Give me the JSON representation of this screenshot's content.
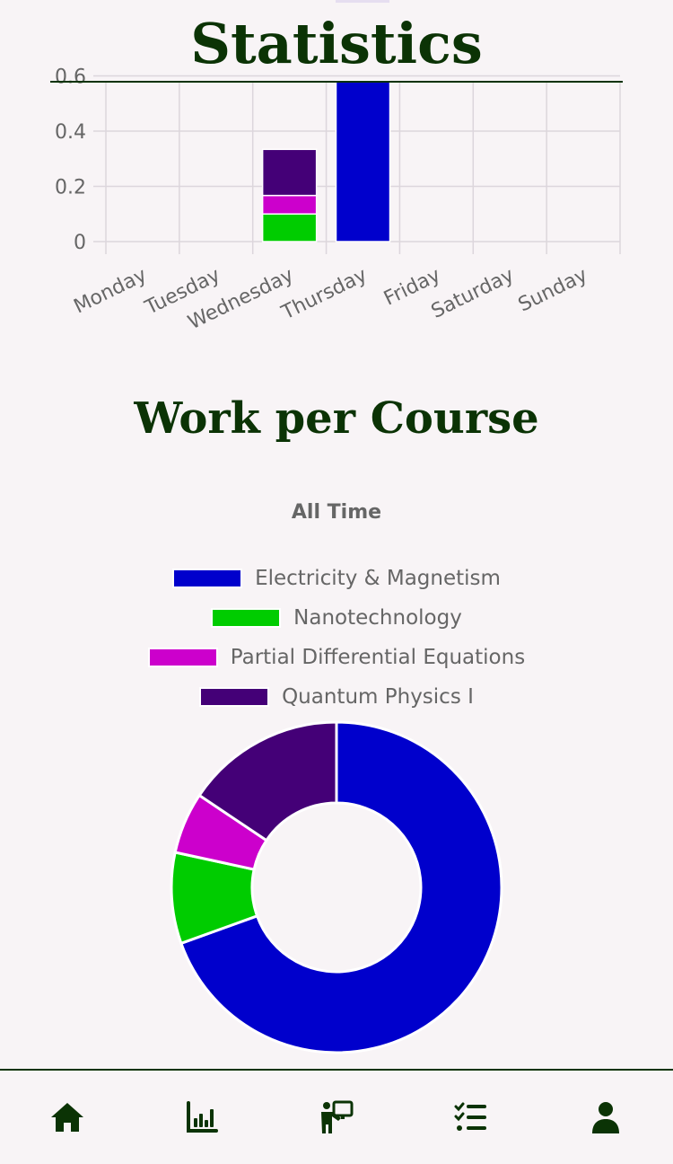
{
  "header": {
    "title": "Statistics"
  },
  "colors": {
    "primary": "#0b3305",
    "electricity_magnetism": "#0000cc",
    "nanotechnology": "#00cc00",
    "pde": "#cc00cc",
    "quantum": "#440077"
  },
  "chart_data": [
    {
      "type": "bar",
      "stacked": true,
      "categories": [
        "Monday",
        "Tuesday",
        "Wednesday",
        "Thursday",
        "Friday",
        "Saturday",
        "Sunday"
      ],
      "series": [
        {
          "name": "Electricity & Magnetism",
          "color": "#0000cc",
          "values": [
            0,
            0,
            0,
            0.6,
            0,
            0,
            0
          ]
        },
        {
          "name": "Nanotechnology",
          "color": "#00cc00",
          "values": [
            0,
            0,
            0.1,
            0,
            0,
            0,
            0
          ]
        },
        {
          "name": "Partial Differential Equations",
          "color": "#cc00cc",
          "values": [
            0,
            0,
            0.067,
            0,
            0,
            0,
            0
          ]
        },
        {
          "name": "Quantum Physics I",
          "color": "#440077",
          "values": [
            0,
            0,
            0.167,
            0,
            0,
            0,
            0
          ]
        }
      ],
      "yticks": [
        "0",
        "0.2",
        "0.4",
        "0.6"
      ],
      "ylim": [
        0,
        0.58
      ],
      "grid": true
    },
    {
      "type": "pie",
      "donut": true,
      "title": "All Time",
      "legend_position": "top",
      "labels": [
        "Electricity & Magnetism",
        "Nanotechnology",
        "Partial Differential Equations",
        "Quantum Physics I"
      ],
      "values": [
        69.5,
        8.9,
        6.0,
        15.6
      ],
      "colors": [
        "#0000cc",
        "#00cc00",
        "#cc00cc",
        "#440077"
      ]
    }
  ],
  "section": {
    "work_per_course_title": "Work per Course"
  },
  "nav": {
    "items": [
      {
        "name": "home",
        "icon": "home-icon"
      },
      {
        "name": "statistics",
        "icon": "bar-chart-icon"
      },
      {
        "name": "teaching",
        "icon": "teacher-icon"
      },
      {
        "name": "tasks",
        "icon": "checklist-icon"
      },
      {
        "name": "profile",
        "icon": "user-icon"
      }
    ]
  }
}
